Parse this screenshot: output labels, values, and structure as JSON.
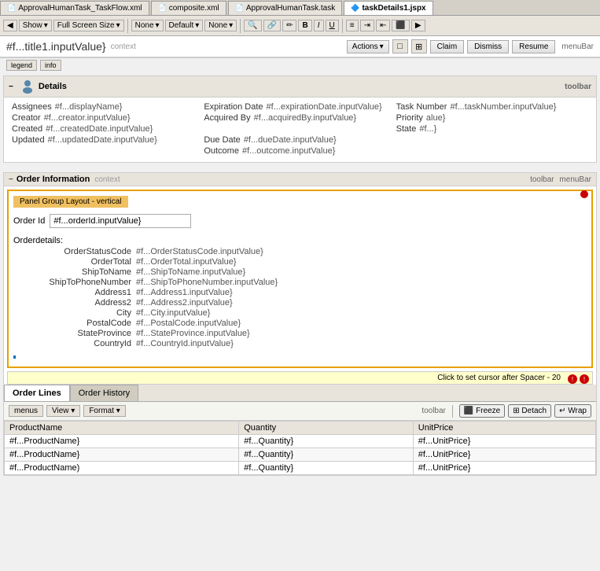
{
  "tabs": [
    {
      "label": "ApprovalHumanTask_TaskFlow.xml",
      "active": false
    },
    {
      "label": "composite.xml",
      "active": false
    },
    {
      "label": "ApprovalHumanTask.task",
      "active": false
    },
    {
      "label": "taskDetails1.jspx",
      "active": true
    }
  ],
  "toolbar": {
    "show_label": "Show",
    "fullscreen_label": "Full Screen Size",
    "none_label1": "None",
    "default_label": "Default",
    "none_label2": "None"
  },
  "header": {
    "title": "#f...title1.inputValue}",
    "context": "context",
    "actions_label": "Actions",
    "claim_label": "Claim",
    "dismiss_label": "Dismiss",
    "resume_label": "Resume",
    "menubar_label": "menuBar"
  },
  "legend": {
    "legend_label": "legend",
    "info_label": "info"
  },
  "details": {
    "section_title": "Details",
    "toolbar_label": "toolbar",
    "assignees_label": "Assignees",
    "assignees_value": "#f...displayName}",
    "expiration_date_label": "Expiration Date",
    "expiration_date_value": "#f...expirationDate.inputValue}",
    "task_number_label": "Task Number",
    "task_number_value": "#f...taskNumber.inputValue}",
    "creator_label": "Creator",
    "creator_value": "#f...creator.inputValue}",
    "acquired_by_label": "Acquired By",
    "acquired_by_value": "#f...acquiredBy.inputValue}",
    "priority_label": "Priority",
    "priority_value": "alue}",
    "created_label": "Created",
    "created_value": "#f...createdDate.inputValue}",
    "state_label": "State",
    "state_value": "#f...}",
    "updated_label": "Updated",
    "updated_value": "#f...updatedDate.inputValue}",
    "due_date_label": "Due Date",
    "due_date_value": "#f...dueDate.inputValue}",
    "outcome_label": "Outcome",
    "outcome_value": "#f...outcome.inputValue}"
  },
  "order_info": {
    "section_title": "Order Information",
    "context_label": "context",
    "toolbar_label": "toolbar",
    "menubar_label": "menuBar",
    "panel_group_label": "Panel Group Layout - vertical",
    "order_id_label": "Order Id",
    "order_id_value": "#f...orderId.inputValue}",
    "order_details_label": "Orderdetails:",
    "rows": [
      {
        "label": "OrderStatusCode",
        "value": "#f...OrderStatusCode.inputValue}"
      },
      {
        "label": "OrderTotal",
        "value": "#f...OrderTotal.inputValue}"
      },
      {
        "label": "ShipToName",
        "value": "#f...ShipToName.inputValue}"
      },
      {
        "label": "ShipToPhoneNumber",
        "value": "#f...ShipToPhoneNumber.inputValue}"
      },
      {
        "label": "Address1",
        "value": "#f...Address1.inputValue}"
      },
      {
        "label": "Address2",
        "value": "#f...Address2.inputValue}"
      },
      {
        "label": "City",
        "value": "#f...City.inputValue}"
      },
      {
        "label": "PostalCode",
        "value": "#f...PostalCode.inputValue}"
      },
      {
        "label": "StateProvince",
        "value": "#f...StateProvince.inputValue}"
      },
      {
        "label": "CountryId",
        "value": "#f...CountryId.inputValue}"
      }
    ],
    "spacer_label": "Click to set cursor after Spacer - 20",
    "tabs": [
      {
        "label": "Order Lines",
        "active": true
      },
      {
        "label": "Order History",
        "active": false
      }
    ]
  },
  "order_lines_toolbar": {
    "menus_label": "menus",
    "view_label": "View",
    "format_label": "Format",
    "toolbar_label": "toolbar",
    "freeze_label": "Freeze",
    "detach_label": "Detach",
    "wrap_label": "Wrap"
  },
  "order_lines_table": {
    "columns": [
      "ProductName",
      "Quantity",
      "UnitPrice"
    ],
    "rows": [
      {
        "product": "#f...ProductName}",
        "qty": "#f...Quantity}",
        "price": "#f...UnitPrice}"
      },
      {
        "product": "#f...ProductName}",
        "qty": "#f...Quantity}",
        "price": "#f...UnitPrice}"
      },
      {
        "product": "#f...ProductName)",
        "qty": "#f...Quantity}",
        "price": "#f...UnitPrice}"
      }
    ]
  }
}
